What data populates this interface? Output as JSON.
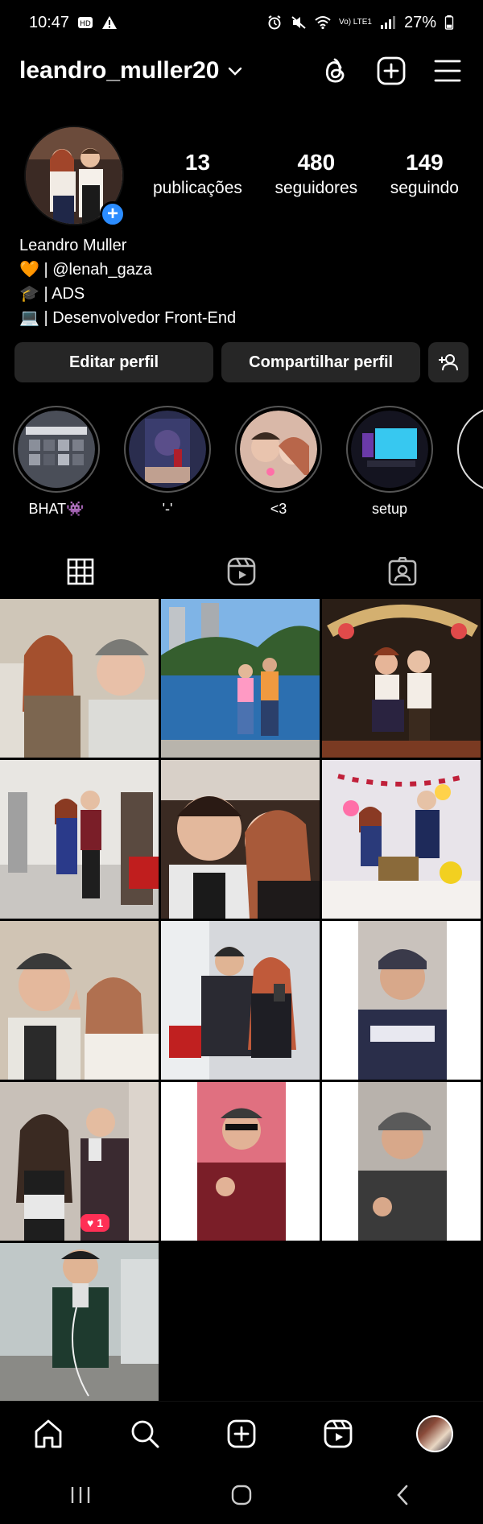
{
  "status_bar": {
    "time": "10:47",
    "battery": "27%",
    "network": "Vo) LTE1"
  },
  "header": {
    "username": "leandro_muller20",
    "icons": [
      "threads-icon",
      "new-post-icon",
      "menu-icon"
    ]
  },
  "profile": {
    "stats": [
      {
        "value": "13",
        "label": "publicações"
      },
      {
        "value": "480",
        "label": "seguidores"
      },
      {
        "value": "149",
        "label": "seguindo"
      }
    ],
    "name": "Leandro Muller",
    "bio_lines": [
      "🧡 | @lenah_gaza",
      "🎓 | ADS",
      "💻 | Desenvolvedor Front-End"
    ]
  },
  "actions": {
    "edit_label": "Editar perfil",
    "share_label": "Compartilhar perfil"
  },
  "highlights": [
    {
      "label": "BHAT👾",
      "color": "#6b6f7a"
    },
    {
      "label": "'-'",
      "color": "#3a3d6e"
    },
    {
      "label": "<3",
      "color": "#c98a7a"
    },
    {
      "label": "setup",
      "color": "#1e7fb8"
    }
  ],
  "tabs": [
    "grid-icon",
    "reels-icon",
    "tagged-icon"
  ],
  "posts": [
    {
      "colors": [
        "#d9d0c2",
        "#7a5a40",
        "#c7c7c2"
      ]
    },
    {
      "colors": [
        "#3a7ac8",
        "#3c6e3a",
        "#6aa0d0"
      ]
    },
    {
      "colors": [
        "#2a1e16",
        "#7a3a22",
        "#d4b070"
      ]
    },
    {
      "colors": [
        "#e8e6e2",
        "#2a3a6a",
        "#7a1e28"
      ]
    },
    {
      "colors": [
        "#3a2a22",
        "#d8d0c8",
        "#a85a3a"
      ]
    },
    {
      "colors": [
        "#e8e4ea",
        "#2a3a7a",
        "#b8a0b0"
      ]
    },
    {
      "colors": [
        "#d0c4b4",
        "#2a2a2a",
        "#b07050"
      ]
    },
    {
      "colors": [
        "#d6d8dc",
        "#2a2a32",
        "#c05a3a"
      ]
    },
    {
      "colors": [
        "#ffffff",
        "#2a2e4a",
        "#8a6a58"
      ]
    },
    {
      "colors": [
        "#c8c0b8",
        "#3a2a30",
        "#b04a5a"
      ],
      "likes": "1"
    },
    {
      "colors": [
        "#ffffff",
        "#7a1e28",
        "#e07080"
      ]
    },
    {
      "colors": [
        "#ffffff",
        "#3a3a3a",
        "#9a7a68"
      ]
    },
    {
      "colors": [
        "#c0c8c8",
        "#1e3a2e",
        "#7a7070"
      ]
    }
  ],
  "bottom_nav": [
    "home-icon",
    "search-icon",
    "create-icon",
    "reels-icon",
    "profile-avatar"
  ]
}
